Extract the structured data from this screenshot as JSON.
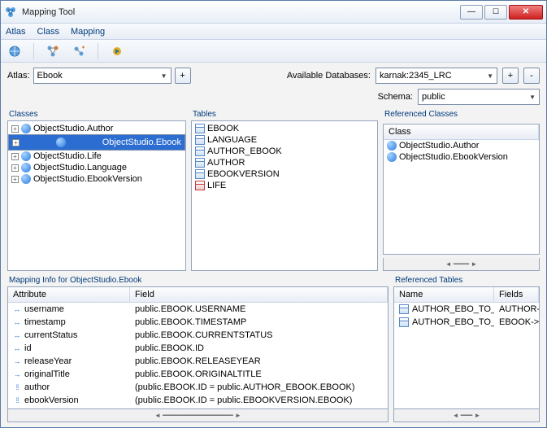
{
  "window": {
    "title": "Mapping Tool"
  },
  "menu": {
    "atlas": "Atlas",
    "class": "Class",
    "mapping": "Mapping"
  },
  "atlas": {
    "label": "Atlas:",
    "value": "Ebook"
  },
  "db": {
    "label": "Available Databases:",
    "value": "karnak:2345_LRC"
  },
  "schema": {
    "label": "Schema:",
    "value": "public"
  },
  "groups": {
    "classes": "Classes",
    "tables": "Tables",
    "refClasses": "Referenced Classes",
    "refClassesHeader": "Class",
    "mappingInfo": "Mapping Info for ObjectStudio.Ebook",
    "refTables": "Referenced Tables"
  },
  "classes": [
    "ObjectStudio.Author",
    "ObjectStudio.Ebook",
    "ObjectStudio.Life",
    "ObjectStudio.Language",
    "ObjectStudio.EbookVersion"
  ],
  "tables": [
    "EBOOK",
    "LANGUAGE",
    "AUTHOR_EBOOK",
    "AUTHOR",
    "EBOOKVERSION",
    "LIFE"
  ],
  "refClasses": [
    "ObjectStudio.Author",
    "ObjectStudio.EbookVersion"
  ],
  "mapHeaders": {
    "attr": "Attribute",
    "field": "Field"
  },
  "mappings": [
    {
      "attr": "username",
      "field": "public.EBOOK.USERNAME",
      "icon": "bi"
    },
    {
      "attr": "timestamp",
      "field": "public.EBOOK.TIMESTAMP",
      "icon": "bi"
    },
    {
      "attr": "currentStatus",
      "field": "public.EBOOK.CURRENTSTATUS",
      "icon": "bi"
    },
    {
      "attr": "id",
      "field": "public.EBOOK.ID",
      "icon": "bi"
    },
    {
      "attr": "releaseYear",
      "field": "public.EBOOK.RELEASEYEAR",
      "icon": "uni"
    },
    {
      "attr": "originalTitle",
      "field": "public.EBOOK.ORIGINALTITLE",
      "icon": "uni"
    },
    {
      "attr": "author",
      "field": "(public.EBOOK.ID = public.AUTHOR_EBOOK.EBOOK)",
      "icon": "multi"
    },
    {
      "attr": "ebookVersion",
      "field": "(public.EBOOK.ID = public.EBOOKVERSION.EBOOK)",
      "icon": "multi"
    }
  ],
  "refTableHeaders": {
    "name": "Name",
    "fields": "Fields"
  },
  "refTables": [
    {
      "name": "AUTHOR_EBO_TO_AUTHOR_ID_...",
      "fields": "AUTHOR->A"
    },
    {
      "name": "AUTHOR_EBO_TO_EBOOK_ID_REF",
      "fields": "EBOOK->E"
    }
  ]
}
